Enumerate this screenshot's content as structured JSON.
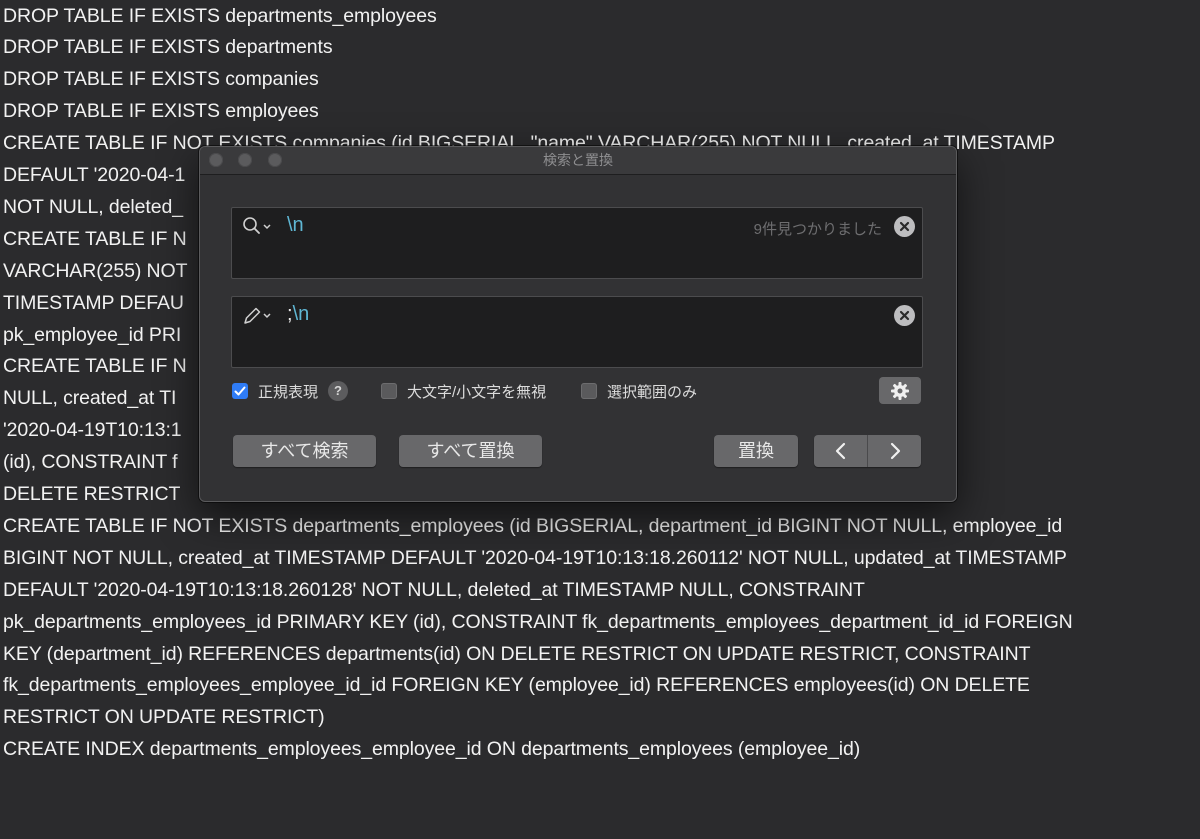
{
  "editor": {
    "lines": [
      "DROP TABLE IF EXISTS departments_employees",
      "DROP TABLE IF EXISTS departments",
      "DROP TABLE IF EXISTS companies",
      "DROP TABLE IF EXISTS employees",
      "CREATE TABLE IF NOT EXISTS companies (id BIGSERIAL, \"name\" VARCHAR(255) NOT NULL, created_at TIMESTAMP",
      "DEFAULT '2020-04-1                                                                          9T10:13:18.258911'",
      "NOT NULL, deleted_",
      "CREATE TABLE IF N                                                                              LL, given_name",
      "VARCHAR(255) NOT                                                                            NULL, updated_at",
      "TIMESTAMP DEFAU                                                                              CONSTRAINT",
      "pk_employee_id PRI",
      "CREATE TABLE IF N                                                                            me\" VARCHAR(255) NOT",
      "NULL, created_at TI                                                                        MESTAMP DEFAULT",
      "'2020-04-19T10:13:1                                                                        rment_id PRIMARY KEY",
      "(id), CONSTRAINT f                                                                          ompanies(id) ON",
      "DELETE RESTRICT",
      "CREATE TABLE IF NOT EXISTS departments_employees (id BIGSERIAL, department_id BIGINT NOT NULL, employee_id",
      "BIGINT NOT NULL, created_at TIMESTAMP DEFAULT '2020-04-19T10:13:18.260112' NOT NULL, updated_at TIMESTAMP",
      "DEFAULT '2020-04-19T10:13:18.260128' NOT NULL, deleted_at TIMESTAMP NULL, CONSTRAINT",
      "pk_departments_employees_id PRIMARY KEY (id), CONSTRAINT fk_departments_employees_department_id_id FOREIGN",
      "KEY (department_id) REFERENCES departments(id) ON DELETE RESTRICT ON UPDATE RESTRICT, CONSTRAINT",
      "fk_departments_employees_employee_id_id FOREIGN KEY (employee_id) REFERENCES employees(id) ON DELETE",
      "RESTRICT ON UPDATE RESTRICT)",
      "CREATE INDEX departments_employees_employee_id ON departments_employees (employee_id)"
    ]
  },
  "dialog": {
    "title": "検索と置換",
    "search": {
      "value": "\\n",
      "match_count": "9件見つかりました",
      "icon": "magnifier-icon"
    },
    "replace": {
      "value_prefix": ";",
      "value_suffix": "\\n",
      "icon": "pencil-icon"
    },
    "options": {
      "regex_label": "正規表現",
      "regex_checked": true,
      "help_label": "?",
      "ignore_case_label": "大文字/小文字を無視",
      "ignore_case_checked": false,
      "selection_only_label": "選択範囲のみ",
      "selection_only_checked": false
    },
    "buttons": {
      "find_all": "すべて検索",
      "replace_all": "すべて置換",
      "replace": "置換"
    },
    "colors": {
      "accent": "#2f7cf6",
      "regex_token": "#5fb7d4"
    }
  }
}
